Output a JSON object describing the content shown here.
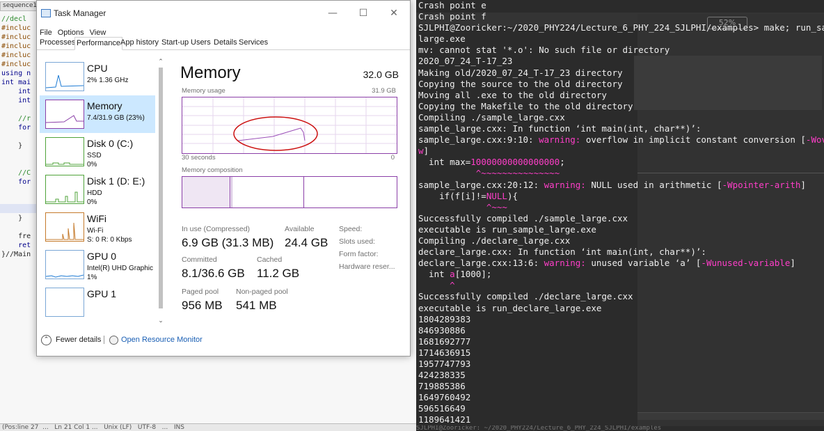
{
  "editor": {
    "tab": "sequence1",
    "code_lines": [
      "//decl",
      "#incluc",
      "#incluc",
      "#incluc",
      "#incluc",
      "#incluc",
      "using n",
      "int mai",
      "    int",
      "    int",
      "",
      "    //r",
      "    for",
      "",
      "    }",
      "",
      "",
      "    //C",
      "    for",
      "",
      "",
      "",
      "    }",
      "",
      "    fre",
      "    ret",
      "}//Main"
    ],
    "status": "(Pos:line 27  ...   Ln 21 Col 1 ...   Unix (LF)   UTF-8   ...   INS"
  },
  "terminal": {
    "zoom": "52%",
    "lines": [
      {
        "t": "Crash point e"
      },
      {
        "t": "Crash point f"
      },
      {
        "t": "SJLPHI@Zooricker:~/2020_PHY224/Lecture_6_PHY_224_SJLPHI/examples> make; run_sa"
      },
      {
        "t": "large.exe"
      },
      {
        "t": "mv: cannot stat '*.o': No such file or directory"
      },
      {
        "t": "2020_07_24_T-17_23"
      },
      {
        "t": "Making old/2020_07_24_T-17_23 directory"
      },
      {
        "t": "Copying the source to the old directory"
      },
      {
        "t": "Moving all .exe to the old directory"
      },
      {
        "t": "Copying the Makefile to the old directory"
      },
      {
        "t": "Compiling ./sample_large.cxx"
      },
      {
        "t": "sample_large.cxx: In function ‘int main(int, char**)’:"
      },
      {
        "a": "sample_large.cxx:9:10: ",
        "w": "warning:",
        "b": " overflow in implicit constant conversion [",
        "w2": "-Wov"
      },
      {
        "w": "w",
        "b": "]"
      },
      {
        "a": "  int max=",
        "w": "10000000000000000",
        "b": ";"
      },
      {
        "c": "           ^~~~~~~~~~~~~~~~"
      },
      {
        "a": "sample_large.cxx:20:12: ",
        "w": "warning:",
        "b": " NULL used in arithmetic [",
        "w2": "-Wpointer-arith",
        "b2": "]"
      },
      {
        "a": "    if(f[i]!=",
        "w": "NULL",
        "b": "){"
      },
      {
        "c": "             ^~~~"
      },
      {
        "t": "Successfully compiled ./sample_large.cxx"
      },
      {
        "t": "executable is run_sample_large.exe"
      },
      {
        "t": "Compiling ./declare_large.cxx"
      },
      {
        "t": "declare_large.cxx: In function ‘int main(int, char**)’:"
      },
      {
        "a": "declare_large.cxx:13:6: ",
        "w": "warning:",
        "b": " unused variable ‘a’ [",
        "w2": "-Wunused-variable",
        "b2": "]"
      },
      {
        "a": "  int ",
        "w": "a",
        "b": "[1000];"
      },
      {
        "c": "      ^"
      },
      {
        "t": "Successfully compiled ./declare_large.cxx"
      },
      {
        "t": "executable is run_declare_large.exe"
      },
      {
        "t": "1804289383"
      },
      {
        "t": "846930886"
      },
      {
        "t": "1681692777"
      },
      {
        "t": "1714636915"
      },
      {
        "t": "1957747793"
      },
      {
        "t": "424238335"
      },
      {
        "t": "719885386"
      },
      {
        "t": "1649760492"
      },
      {
        "t": "596516649"
      },
      {
        "t": "1189641421"
      }
    ],
    "status": "SJLPHI@Zooricker: ~/2020_PHY224/Lecture_6_PHY_224_SJLPHI/examples"
  },
  "task_manager": {
    "title": "Task Manager",
    "minimize": "—",
    "maximize": "☐",
    "close": "✕",
    "menu": [
      "File",
      "Options",
      "View"
    ],
    "tabs": [
      "Processes",
      "Performance",
      "App history",
      "Start-up",
      "Users",
      "Details",
      "Services"
    ],
    "active_tab": "Performance",
    "sidebar": [
      {
        "name": "CPU",
        "s1": "2% 1.36 GHz",
        "s2": "",
        "color": "#1c7ad4"
      },
      {
        "name": "Memory",
        "s1": "7.4/31.9 GB (23%)",
        "s2": "",
        "color": "#8b3fa8"
      },
      {
        "name": "Disk 0 (C:)",
        "s1": "SSD",
        "s2": "0%",
        "color": "#4fa33a"
      },
      {
        "name": "Disk 1 (D: E:)",
        "s1": "HDD",
        "s2": "0%",
        "color": "#4fa33a"
      },
      {
        "name": "WiFi",
        "s1": "Wi-Fi",
        "s2": "S: 0 R: 0 Kbps",
        "color": "#c57a2b"
      },
      {
        "name": "GPU 0",
        "s1": "Intel(R) UHD Graphic",
        "s2": "1%",
        "color": "#1c7ad4"
      },
      {
        "name": "GPU 1",
        "s1": "",
        "s2": "",
        "color": "#1c7ad4"
      }
    ],
    "selected": "Memory",
    "main": {
      "title": "Memory",
      "total": "32.0 GB",
      "usage_label": "Memory usage",
      "usage_max": "31.9 GB",
      "time_label": "30 seconds",
      "time_min": "0",
      "composition_label": "Memory composition",
      "in_use_label": "In use (Compressed)",
      "in_use_value": "6.9 GB (31.3 MB)",
      "available_label": "Available",
      "available_value": "24.4 GB",
      "committed_label": "Committed",
      "committed_value": "8.1/36.6 GB",
      "cached_label": "Cached",
      "cached_value": "11.2 GB",
      "paged_label": "Paged pool",
      "paged_value": "956 MB",
      "nonpaged_label": "Non-paged pool",
      "nonpaged_value": "541 MB",
      "spec_labels": [
        "Speed:",
        "Slots used:",
        "Form factor:",
        "Hardware reser..."
      ],
      "accent": "#8b3fa8",
      "annotation_color": "#cc1111"
    },
    "footer": {
      "fewer": "Fewer details",
      "open_monitor": "Open Resource Monitor"
    }
  }
}
